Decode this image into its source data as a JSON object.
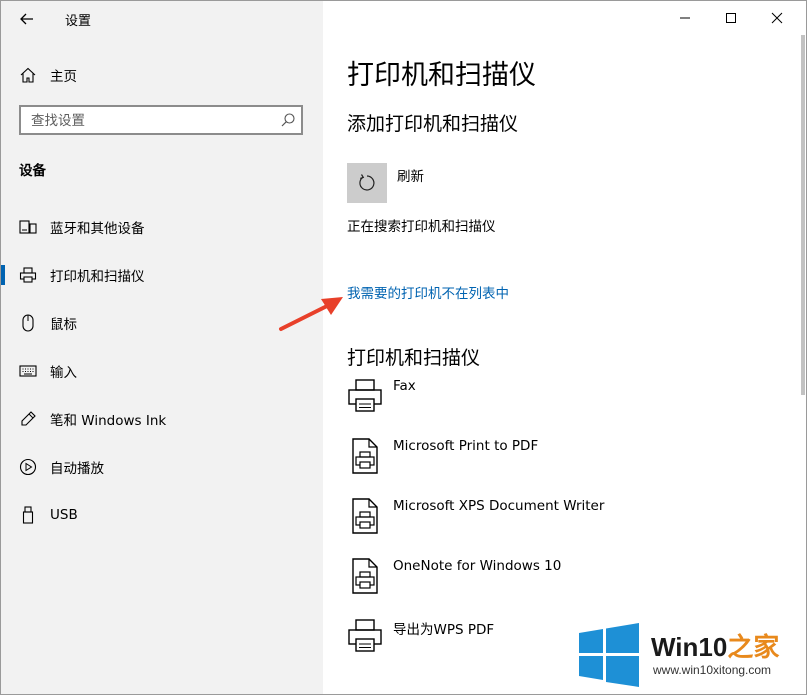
{
  "window": {
    "title": "设置",
    "controls": [
      "minimize",
      "maximize",
      "close"
    ]
  },
  "sidebar": {
    "home_label": "主页",
    "search_placeholder": "查找设置",
    "section_title": "设备",
    "items": [
      {
        "label": "蓝牙和其他设备",
        "icon": "bluetooth-devices-icon"
      },
      {
        "label": "打印机和扫描仪",
        "icon": "printer-icon",
        "active": true
      },
      {
        "label": "鼠标",
        "icon": "mouse-icon"
      },
      {
        "label": "输入",
        "icon": "keyboard-icon"
      },
      {
        "label": "笔和 Windows Ink",
        "icon": "pen-icon"
      },
      {
        "label": "自动播放",
        "icon": "autoplay-icon"
      },
      {
        "label": "USB",
        "icon": "usb-icon"
      }
    ]
  },
  "main": {
    "page_title": "打印机和扫描仪",
    "add_section_title": "添加打印机和扫描仪",
    "refresh_label": "刷新",
    "status_text": "正在搜索打印机和扫描仪",
    "missing_printer_link": "我需要的打印机不在列表中",
    "list_section_title": "打印机和扫描仪",
    "printers": [
      {
        "name": "Fax",
        "icon": "printer-icon"
      },
      {
        "name": "Microsoft Print to PDF",
        "icon": "document-printer-icon"
      },
      {
        "name": "Microsoft XPS Document Writer",
        "icon": "document-printer-icon"
      },
      {
        "name": "OneNote for Windows 10",
        "icon": "document-printer-icon"
      },
      {
        "name": "导出为WPS PDF",
        "icon": "printer-icon"
      }
    ]
  },
  "watermark": {
    "brand": "Win10",
    "brand_suffix": "之家",
    "url": "www.win10xitong.com"
  },
  "colors": {
    "accent": "#0063b1",
    "sidebar_bg": "#f2f2f2",
    "arrow": "#e8402a"
  }
}
